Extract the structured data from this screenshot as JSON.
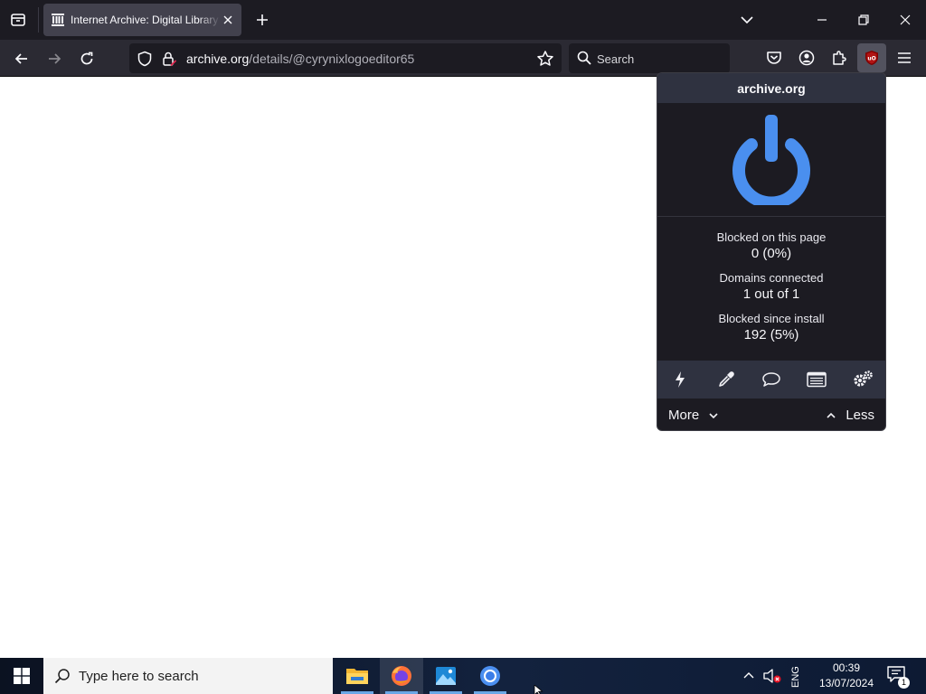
{
  "tabbar": {
    "tab_title": "Internet Archive: Digital Library"
  },
  "navbar": {
    "url_host": "archive.org",
    "url_path": "/details/@cyrynixlogoeditor65",
    "search_placeholder": "Search"
  },
  "popup": {
    "hostname": "archive.org",
    "power_color": "#4a8fef",
    "stats": [
      {
        "label": "Blocked on this page",
        "value": "0 (0%)"
      },
      {
        "label": "Domains connected",
        "value": "1 out of 1"
      },
      {
        "label": "Blocked since install",
        "value": "192 (5%)"
      }
    ],
    "tools": [
      "lightning-icon",
      "eyedropper-icon",
      "speech-bubble-icon",
      "list-icon",
      "gears-icon"
    ],
    "more_label": "More",
    "less_label": "Less"
  },
  "taskbar": {
    "search_placeholder": "Type here to search",
    "language": "ENG",
    "time": "00:39",
    "date": "13/07/2024",
    "notification_count": "1"
  }
}
